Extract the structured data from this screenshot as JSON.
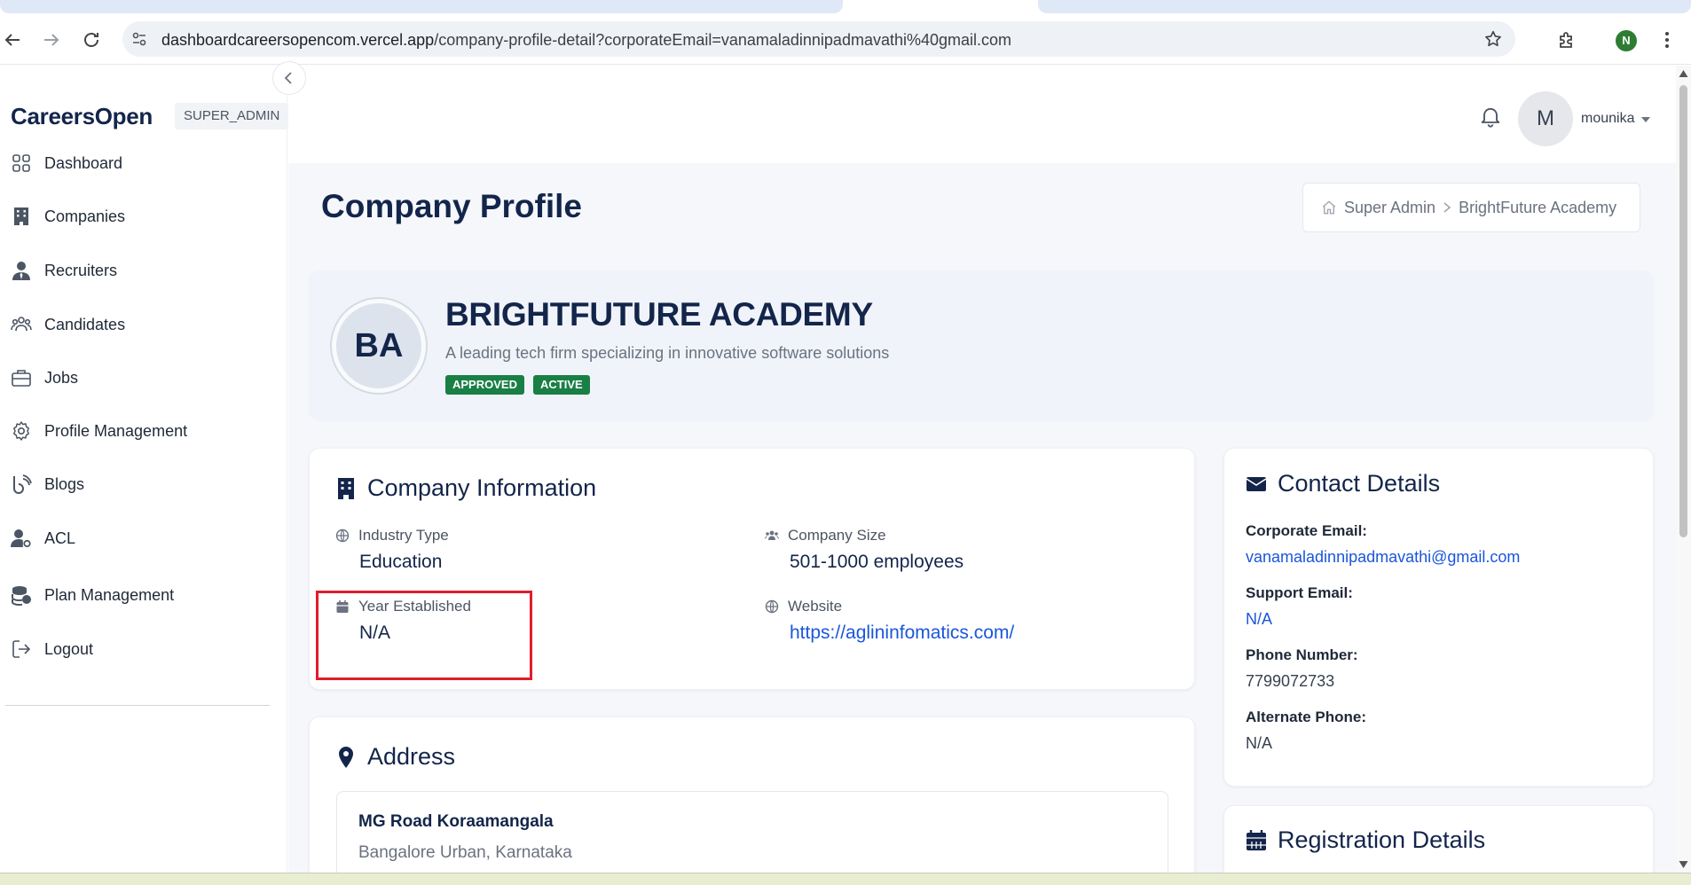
{
  "browser": {
    "url_host": "dashboardcareersopencom.vercel.app",
    "url_path": "/company-profile-detail?corporateEmail=vanamaladinnipadmavathi%40gmail.com",
    "profile_initial": "N"
  },
  "sidebar": {
    "logo": "CareersOpen",
    "role": "SUPER_ADMIN",
    "items": [
      {
        "label": "Dashboard",
        "icon": "grid-icon"
      },
      {
        "label": "Companies",
        "icon": "building-icon"
      },
      {
        "label": "Recruiters",
        "icon": "user-tie-icon"
      },
      {
        "label": "Candidates",
        "icon": "users-icon"
      },
      {
        "label": "Jobs",
        "icon": "briefcase-icon"
      },
      {
        "label": "Profile Management",
        "icon": "gear-icon"
      },
      {
        "label": "Blogs",
        "icon": "blog-icon"
      },
      {
        "label": "ACL",
        "icon": "user-cog-icon"
      },
      {
        "label": "Plan Management",
        "icon": "coins-icon"
      },
      {
        "label": "Logout",
        "icon": "logout-icon"
      }
    ]
  },
  "header": {
    "avatar_initial": "M",
    "user_name": "mounika"
  },
  "page": {
    "title": "Company Profile",
    "breadcrumb": [
      "Super Admin",
      "BrightFuture Academy"
    ]
  },
  "company": {
    "initials": "BA",
    "name": "BRIGHTFUTURE ACADEMY",
    "tagline": "A leading tech firm specializing in innovative software solutions",
    "badges": [
      "APPROVED",
      "ACTIVE"
    ],
    "badge_color": "#1a7f45"
  },
  "company_info": {
    "title": "Company Information",
    "industry_type_label": "Industry Type",
    "industry_type": "Education",
    "company_size_label": "Company Size",
    "company_size": "501-1000 employees",
    "year_established_label": "Year Established",
    "year_established": "N/A",
    "website_label": "Website",
    "website": "https://aglininfomatics.com/"
  },
  "contact": {
    "title": "Contact Details",
    "corporate_email_label": "Corporate Email:",
    "corporate_email": "vanamaladinnipadmavathi@gmail.com",
    "support_email_label": "Support Email:",
    "support_email": "N/A",
    "phone_label": "Phone Number:",
    "phone": "7799072733",
    "alt_phone_label": "Alternate Phone:",
    "alt_phone": "N/A"
  },
  "address": {
    "title": "Address",
    "line1": "MG Road Koraamangala",
    "line2": "Bangalore Urban, Karnataka"
  },
  "registration": {
    "title": "Registration Details"
  },
  "colors": {
    "brand_navy": "#13254a",
    "link_blue": "#1a56db",
    "highlight_red": "#e11d2a"
  }
}
